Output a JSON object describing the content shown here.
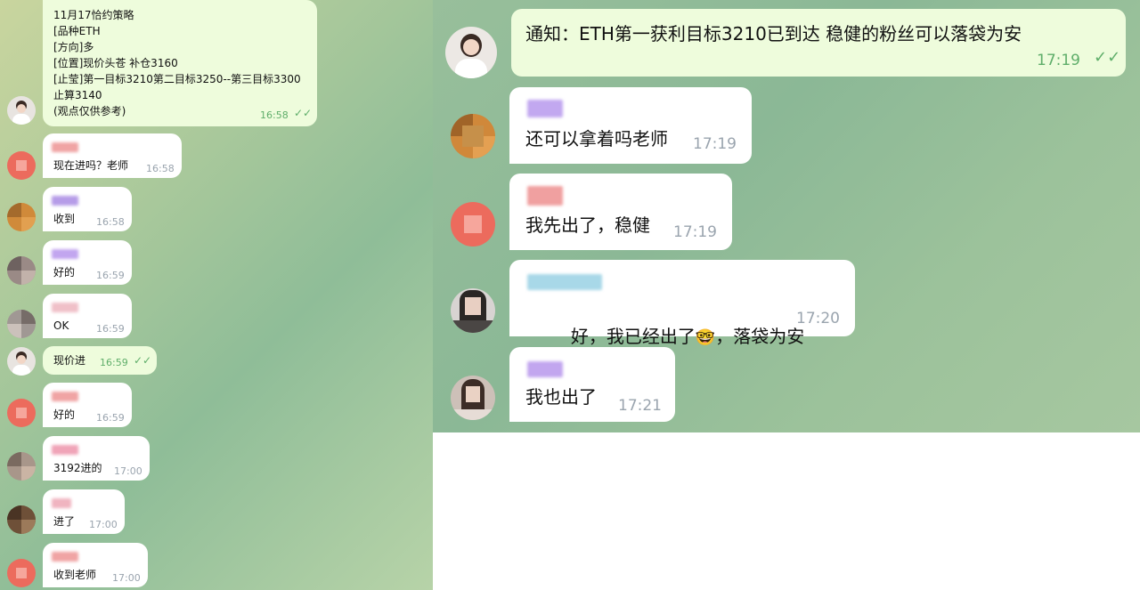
{
  "left": {
    "strategy": {
      "lines": [
        "11月17恰约策略",
        "[品种ETH",
        "[方向]多",
        "[位置]现价头苍 补仓3160",
        "[止莹]第一目标3210第二目标3250--第三目标3300",
        "止算3140",
        "(观点仅供参考)"
      ],
      "time": "16:58"
    },
    "messages": [
      {
        "text": "现在进吗？老师",
        "time": "16:58"
      },
      {
        "text": "收到",
        "time": "16:58"
      },
      {
        "text": "好的",
        "time": "16:59"
      },
      {
        "text": "OK",
        "time": "16:59"
      },
      {
        "text": "现价进",
        "time": "16:59"
      },
      {
        "text": "好的",
        "time": "16:59"
      },
      {
        "text": "3192进的",
        "time": "17:00"
      },
      {
        "text": "进了",
        "time": "17:00"
      },
      {
        "text": "收到老师",
        "time": "17:00"
      }
    ]
  },
  "right": {
    "notice": {
      "text": "通知：ETH第一获利目标3210已到达 稳健的粉丝可以落袋为安",
      "time": "17:19"
    },
    "messages": [
      {
        "text": "还可以拿着吗老师",
        "time": "17:19"
      },
      {
        "text": "我先出了，稳健",
        "time": "17:19"
      },
      {
        "text_before": "好，我已经出了",
        "emoji": "🤓",
        "text_after": "，落袋为安",
        "time": "17:20"
      },
      {
        "text": "我也出了",
        "time": "17:21"
      }
    ]
  },
  "icons": {
    "read": "double-check-icon"
  }
}
